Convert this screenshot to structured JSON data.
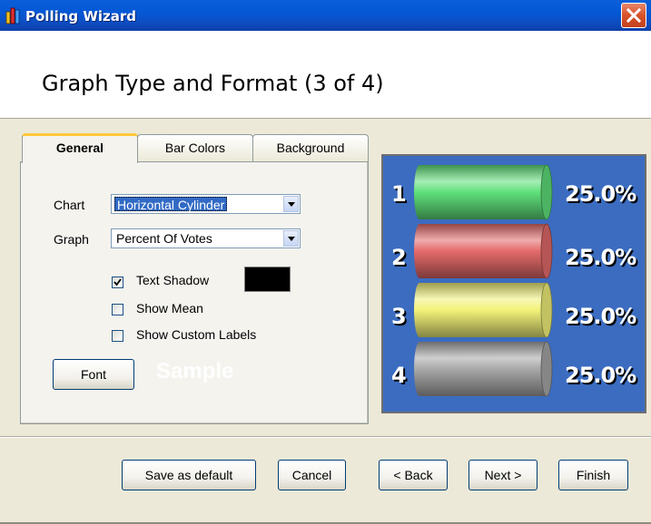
{
  "window": {
    "title": "Polling Wizard"
  },
  "header": {
    "heading": "Graph Type and Format (3 of 4)"
  },
  "tabs": [
    {
      "label": "General",
      "active": true
    },
    {
      "label": "Bar Colors",
      "active": false
    },
    {
      "label": "Background",
      "active": false
    }
  ],
  "general": {
    "chart_label": "Chart",
    "chart_value": "Horizontal Cylinder",
    "graph_label": "Graph",
    "graph_value": "Percent Of Votes",
    "text_shadow": {
      "label": "Text Shadow",
      "checked": true,
      "color": "#000000"
    },
    "show_mean": {
      "label": "Show Mean",
      "checked": false
    },
    "show_custom_labels": {
      "label": "Show Custom Labels",
      "checked": false
    },
    "font_button": "Font",
    "sample_text": "Sample"
  },
  "preview": {
    "background": "#3b6cc0",
    "rows": [
      {
        "number": "1",
        "percent": "25.0%",
        "color": "#5fe07a"
      },
      {
        "number": "2",
        "percent": "25.0%",
        "color": "#e46a6a"
      },
      {
        "number": "3",
        "percent": "25.0%",
        "color": "#f2f27a"
      },
      {
        "number": "4",
        "percent": "25.0%",
        "color": "#a8a8a8"
      }
    ]
  },
  "buttons": {
    "save_default": "Save as default",
    "cancel": "Cancel",
    "back": "< Back",
    "next": "Next >",
    "finish": "Finish"
  }
}
